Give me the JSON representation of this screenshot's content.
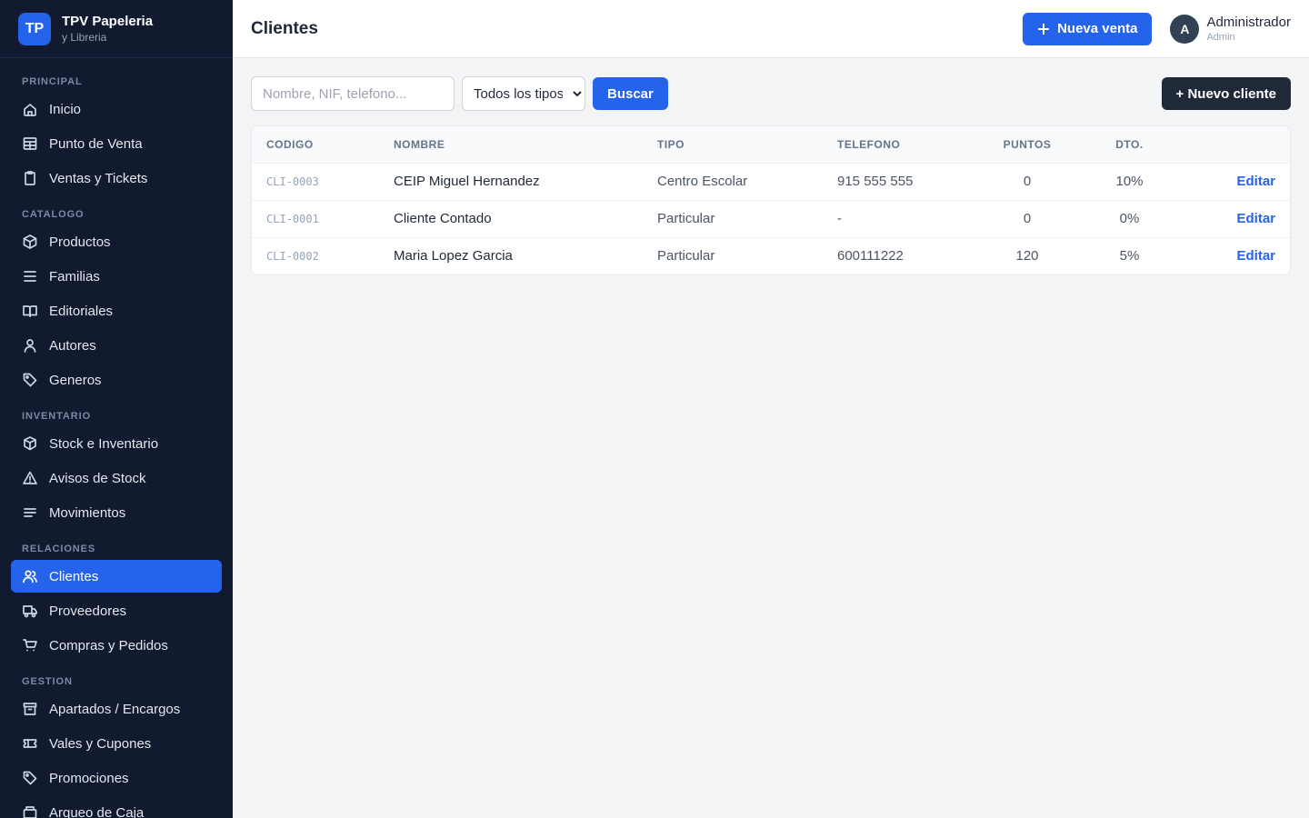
{
  "brand": {
    "logo": "TP",
    "title": "TPV Papeleria",
    "subtitle": "y Libreria"
  },
  "sidebar": {
    "sections": [
      {
        "label": "PRINCIPAL",
        "items": [
          {
            "label": "Inicio",
            "icon": "home-icon"
          },
          {
            "label": "Punto de Venta",
            "icon": "pos-icon"
          },
          {
            "label": "Ventas y Tickets",
            "icon": "clipboard-icon"
          }
        ]
      },
      {
        "label": "CATALOGO",
        "items": [
          {
            "label": "Productos",
            "icon": "box-icon"
          },
          {
            "label": "Familias",
            "icon": "list-icon"
          },
          {
            "label": "Editoriales",
            "icon": "book-icon"
          },
          {
            "label": "Autores",
            "icon": "user-icon"
          },
          {
            "label": "Generos",
            "icon": "tag-icon"
          }
        ]
      },
      {
        "label": "INVENTARIO",
        "items": [
          {
            "label": "Stock e Inventario",
            "icon": "cube-icon"
          },
          {
            "label": "Avisos de Stock",
            "icon": "warning-icon"
          },
          {
            "label": "Movimientos",
            "icon": "lines-icon"
          }
        ]
      },
      {
        "label": "RELACIONES",
        "items": [
          {
            "label": "Clientes",
            "icon": "users-icon",
            "active": true
          },
          {
            "label": "Proveedores",
            "icon": "truck-icon"
          },
          {
            "label": "Compras y Pedidos",
            "icon": "cart-icon"
          }
        ]
      },
      {
        "label": "GESTION",
        "items": [
          {
            "label": "Apartados / Encargos",
            "icon": "archive-icon"
          },
          {
            "label": "Vales y Cupones",
            "icon": "ticket-icon"
          },
          {
            "label": "Promociones",
            "icon": "tag-icon"
          },
          {
            "label": "Arqueo de Caja",
            "icon": "register-icon"
          }
        ]
      }
    ]
  },
  "header": {
    "title": "Clientes",
    "new_sale_label": "Nueva venta",
    "user": {
      "initial": "A",
      "name": "Administrador",
      "role": "Admin"
    }
  },
  "toolbar": {
    "search_placeholder": "Nombre, NIF, telefono...",
    "type_select": {
      "selected": "Todos los tipos"
    },
    "search_label": "Buscar",
    "new_client_label": "+ Nuevo cliente"
  },
  "table": {
    "columns": [
      "CODIGO",
      "NOMBRE",
      "TIPO",
      "TELEFONO",
      "PUNTOS",
      "DTO."
    ],
    "rows": [
      {
        "code": "CLI-0003",
        "name": "CEIP Miguel Hernandez",
        "type": "Centro Escolar",
        "phone": "915 555 555",
        "points": "0",
        "discount": "10%",
        "action": "Editar"
      },
      {
        "code": "CLI-0001",
        "name": "Cliente Contado",
        "type": "Particular",
        "phone": "-",
        "points": "0",
        "discount": "0%",
        "action": "Editar"
      },
      {
        "code": "CLI-0002",
        "name": "Maria Lopez Garcia",
        "type": "Particular",
        "phone": "600111222",
        "points": "120",
        "discount": "5%",
        "action": "Editar"
      }
    ]
  },
  "colors": {
    "sidebar_bg": "#111a2e",
    "accent": "#2563eb",
    "dark_button": "#1f2937"
  }
}
